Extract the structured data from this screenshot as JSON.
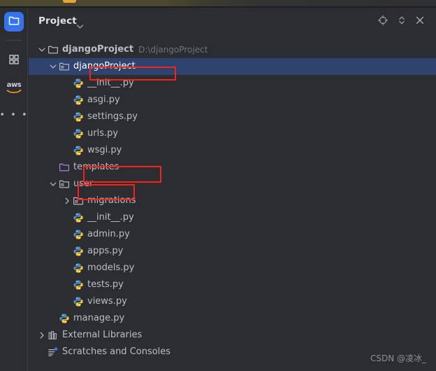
{
  "window": {
    "background_color": "#2b2d30",
    "top_strip_color": "#4b482f",
    "accent_color": "#3574f0",
    "selection_color": "#2e436e",
    "annotation_color": "#f4241d"
  },
  "rail": {
    "items": [
      {
        "id": "project",
        "icon": "folder-icon",
        "label": "Project",
        "active": true
      },
      {
        "id": "plugins",
        "icon": "grid-squares-icon",
        "label": "Plugins",
        "active": false
      },
      {
        "id": "aws",
        "icon": "aws-logo-icon",
        "label": "aws",
        "active": false
      },
      {
        "id": "more",
        "icon": "more-horizontal-icon",
        "label": "More tool windows",
        "active": false
      }
    ]
  },
  "header": {
    "title": "Project",
    "chevron_icon": "chevron-down-icon",
    "buttons": [
      {
        "id": "locate",
        "icon": "target-crosshair-icon",
        "tooltip": "Select Opened File"
      },
      {
        "id": "expand",
        "icon": "expand-collapse-icon",
        "tooltip": "Expand All"
      },
      {
        "id": "close",
        "icon": "close-icon",
        "tooltip": "Hide"
      }
    ]
  },
  "tree": {
    "rows": [
      {
        "indent": 0,
        "twisty": "expanded",
        "icon": "folder-icon",
        "label": "djangoProject",
        "sublabel": "D:\\djangoProject",
        "selected": false,
        "bold": true
      },
      {
        "indent": 1,
        "twisty": "expanded",
        "icon": "module-folder-icon",
        "label": "djangoProject",
        "sublabel": "",
        "selected": true,
        "bold": false
      },
      {
        "indent": 2,
        "twisty": "none",
        "icon": "python-file-icon",
        "label": "__init__.py",
        "sublabel": "",
        "selected": false,
        "bold": false
      },
      {
        "indent": 2,
        "twisty": "none",
        "icon": "python-file-icon",
        "label": "asgi.py",
        "sublabel": "",
        "selected": false,
        "bold": false
      },
      {
        "indent": 2,
        "twisty": "none",
        "icon": "python-file-icon",
        "label": "settings.py",
        "sublabel": "",
        "selected": false,
        "bold": false
      },
      {
        "indent": 2,
        "twisty": "none",
        "icon": "python-file-icon",
        "label": "urls.py",
        "sublabel": "",
        "selected": false,
        "bold": false
      },
      {
        "indent": 2,
        "twisty": "none",
        "icon": "python-file-icon",
        "label": "wsgi.py",
        "sublabel": "",
        "selected": false,
        "bold": false
      },
      {
        "indent": 1,
        "twisty": "none",
        "icon": "template-folder-icon",
        "label": "templates",
        "sublabel": "",
        "selected": false,
        "bold": false
      },
      {
        "indent": 1,
        "twisty": "expanded",
        "icon": "module-folder-icon",
        "label": "user",
        "sublabel": "",
        "selected": false,
        "bold": false
      },
      {
        "indent": 2,
        "twisty": "collapsed",
        "icon": "module-folder-icon",
        "label": "migrations",
        "sublabel": "",
        "selected": false,
        "bold": false
      },
      {
        "indent": 2,
        "twisty": "none",
        "icon": "python-file-icon",
        "label": "__init__.py",
        "sublabel": "",
        "selected": false,
        "bold": false
      },
      {
        "indent": 2,
        "twisty": "none",
        "icon": "python-file-icon",
        "label": "admin.py",
        "sublabel": "",
        "selected": false,
        "bold": false
      },
      {
        "indent": 2,
        "twisty": "none",
        "icon": "python-file-icon",
        "label": "apps.py",
        "sublabel": "",
        "selected": false,
        "bold": false
      },
      {
        "indent": 2,
        "twisty": "none",
        "icon": "python-file-icon",
        "label": "models.py",
        "sublabel": "",
        "selected": false,
        "bold": false
      },
      {
        "indent": 2,
        "twisty": "none",
        "icon": "python-file-icon",
        "label": "tests.py",
        "sublabel": "",
        "selected": false,
        "bold": false
      },
      {
        "indent": 2,
        "twisty": "none",
        "icon": "python-file-icon",
        "label": "views.py",
        "sublabel": "",
        "selected": false,
        "bold": false
      },
      {
        "indent": 1,
        "twisty": "none",
        "icon": "python-file-icon",
        "label": "manage.py",
        "sublabel": "",
        "selected": false,
        "bold": false
      },
      {
        "indent": 0,
        "twisty": "collapsed",
        "icon": "external-libraries-icon",
        "label": "External Libraries",
        "sublabel": "",
        "selected": false,
        "bold": false
      },
      {
        "indent": 0,
        "twisty": "none",
        "icon": "scratches-icon",
        "label": "Scratches and Consoles",
        "sublabel": "",
        "selected": false,
        "bold": false
      }
    ]
  },
  "annotations": [
    {
      "id": "inner-project",
      "target": "djangoProject"
    },
    {
      "id": "templates",
      "target": "templates"
    },
    {
      "id": "user",
      "target": "user"
    }
  ],
  "watermark": {
    "text": "CSDN @凌冰_"
  }
}
